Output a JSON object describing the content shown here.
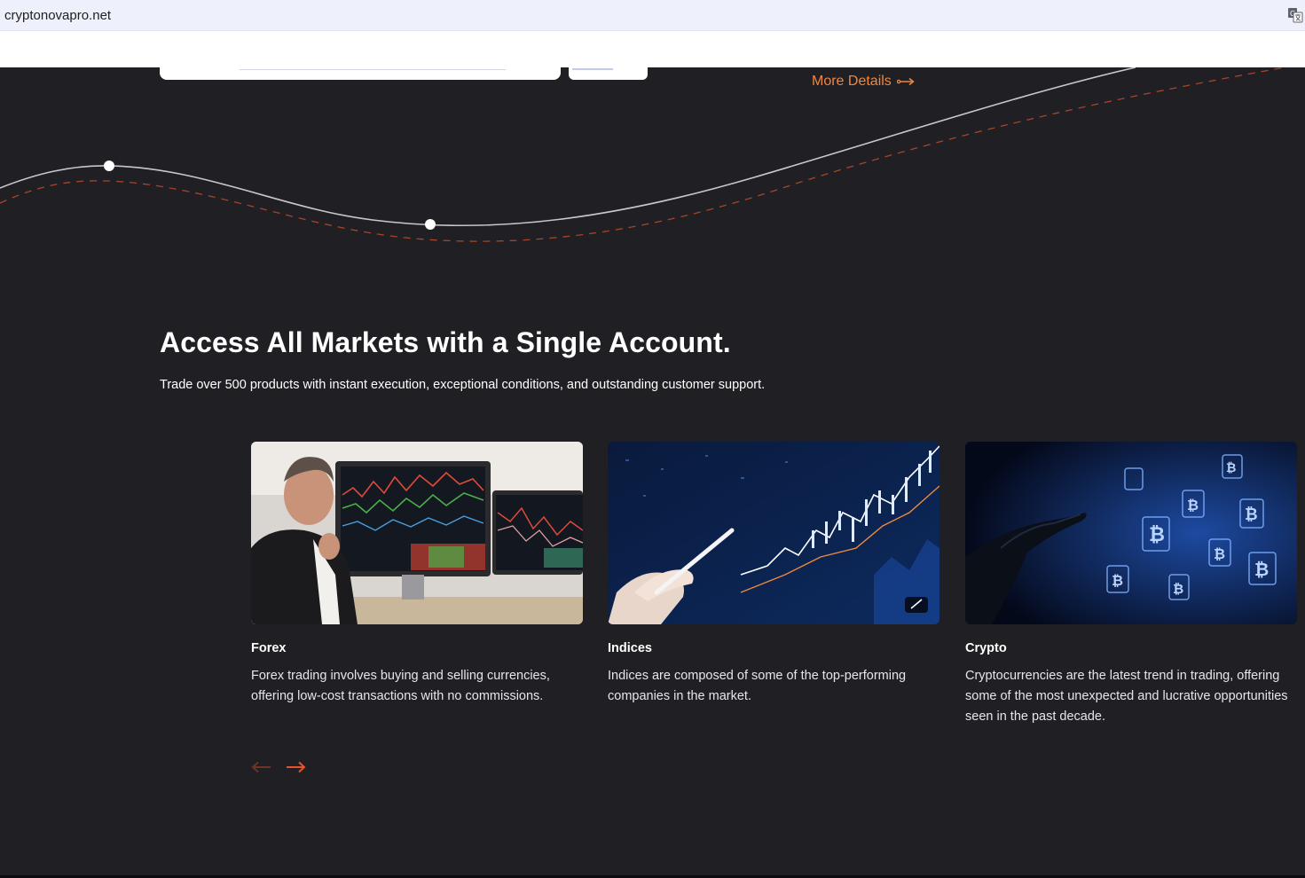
{
  "browser": {
    "url": "cryptonovapro.net",
    "translate_icon": "translate-icon"
  },
  "hero_remnant": {
    "more_details_label": "More Details",
    "more_details_icon": "long-arrow-right-icon",
    "accent_color": "#f2863c"
  },
  "markets": {
    "heading": "Access All Markets with a Single Account.",
    "subheading": "Trade over 500 products with instant execution, exceptional conditions, and outstanding customer support.",
    "cards": [
      {
        "title": "Forex",
        "description": "Forex trading involves buying and selling currencies, offering low-cost transactions with no commissions.",
        "image": "trader-at-monitors-photo"
      },
      {
        "title": "Indices",
        "description": "Indices are composed of some of the top-performing companies in the market.",
        "image": "hand-with-stylus-chart-photo"
      },
      {
        "title": "Crypto",
        "description": "Cryptocurrencies are the latest trend in trading, offering some of the most unexpected and lucrative opportunities seen in the past decade.",
        "image": "hand-touching-bitcoin-icons-photo"
      }
    ],
    "prev_icon": "arrow-left-icon",
    "next_icon": "arrow-right-icon",
    "arrow_color": "#e8522a",
    "arrow_disabled_color": "#6b3424"
  },
  "colors": {
    "background": "#202024",
    "text": "#ffffff"
  }
}
